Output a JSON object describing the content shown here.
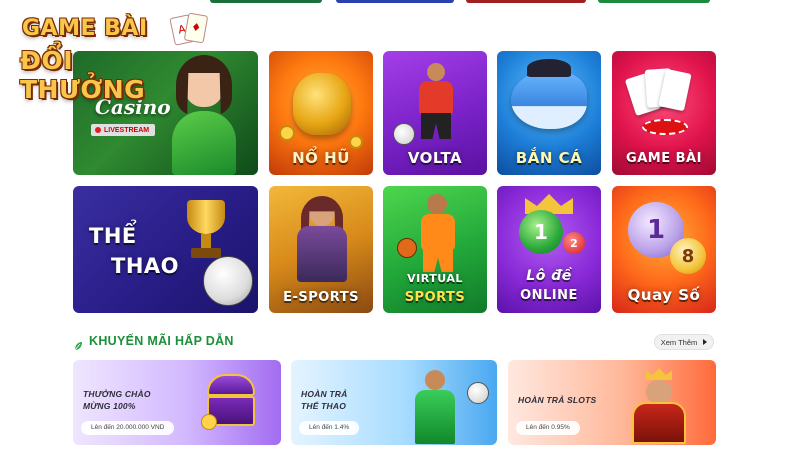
{
  "logo": {
    "line1": "GAME BÀI",
    "line2": "ĐỔI THƯỞNG",
    "card_1": "A",
    "card_2": "♦"
  },
  "colors": {
    "accent_green": "#1d8f3a",
    "logo_gold": "#f7c64a"
  },
  "games": [
    {
      "label": "Casino",
      "badge": "LIVESTREAM"
    },
    {
      "label": "NỔ HŨ"
    },
    {
      "label": "VOLTA"
    },
    {
      "label": "BẮN CÁ"
    },
    {
      "label": "GAME BÀI"
    },
    {
      "label_line1": "THỂ",
      "label_line2": "THAO"
    },
    {
      "label": "E-SPORTS"
    },
    {
      "label_line1": "VIRTUAL",
      "label_line2": "SPORTS"
    },
    {
      "label_line1": "Lô đề",
      "label_line2": "ONLINE",
      "ball_1": "1",
      "ball_2": "2"
    },
    {
      "label": "Quay Số",
      "ball_1": "1",
      "ball_2": "8"
    }
  ],
  "promotions_section": {
    "title": "KHUYẾN MÃI HẤP DẪN",
    "see_more": "Xem Thêm"
  },
  "promotions": [
    {
      "title_line1": "THƯỞNG CHÀO",
      "title_line2": "MỪNG 100%",
      "pill": "Lên đến 20.000.000 VND"
    },
    {
      "title_line1": "HOÀN TRẢ",
      "title_line2": "THỂ THAO",
      "pill": "Lên đến 1.4%"
    },
    {
      "title_line1": "HOÀN TRẢ SLOTS",
      "pill": "Lên đến 0.95%"
    }
  ]
}
